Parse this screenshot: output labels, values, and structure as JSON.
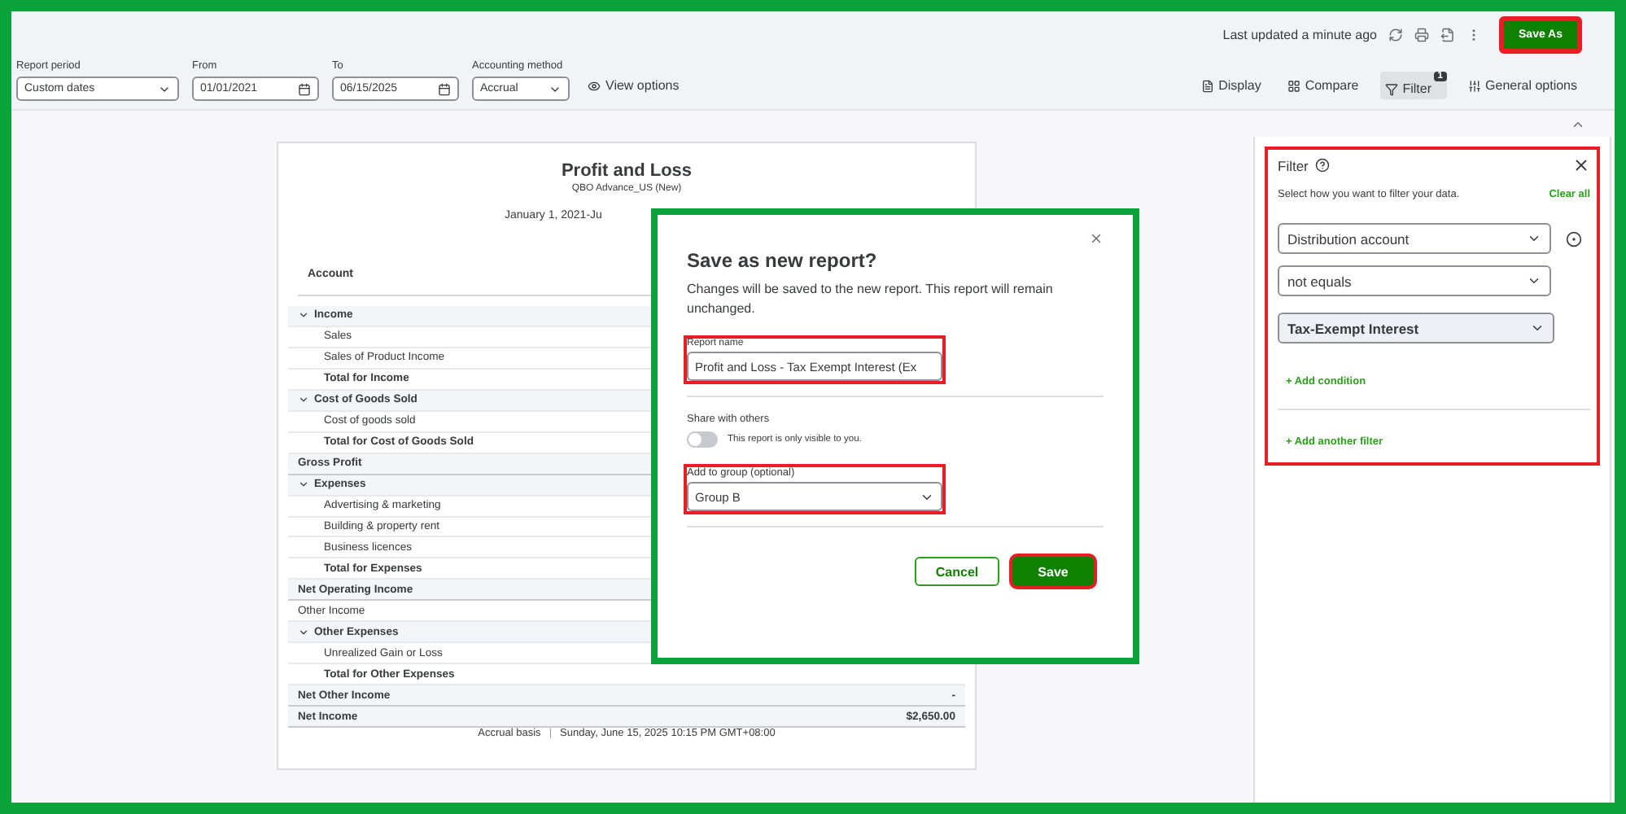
{
  "header": {
    "last_updated": "Last updated a minute ago",
    "save_as": {
      "label": "Save As",
      "highlighted": true
    }
  },
  "controls": [
    {
      "kind": "select",
      "label": "Report period",
      "value": "Custom dates"
    },
    {
      "kind": "date",
      "label": "From",
      "value": "01/01/2021"
    },
    {
      "kind": "date",
      "label": "To",
      "value": "06/15/2025"
    },
    {
      "kind": "select",
      "label": "Accounting method",
      "value": "Accrual"
    }
  ],
  "view_options": "View options",
  "tools": [
    {
      "kind": "display",
      "label": "Display",
      "selected": false
    },
    {
      "kind": "compare",
      "label": "Compare",
      "selected": false
    },
    {
      "kind": "filter",
      "label": "Filter",
      "selected": true,
      "badge": "1"
    },
    {
      "kind": "options",
      "label": "General options",
      "selected": false
    }
  ],
  "report": {
    "title": "Profit and Loss",
    "company": "QBO Advance_US (New)",
    "date_range": "January 1, 2021-Ju",
    "column": "Account",
    "rows": [
      {
        "kind": "section",
        "label": "Income",
        "expanded": true
      },
      {
        "kind": "item",
        "label": "Sales"
      },
      {
        "kind": "item",
        "label": "Sales of Product Income"
      },
      {
        "kind": "total",
        "label": "Total for Income"
      },
      {
        "kind": "section",
        "label": "Cost of Goods Sold",
        "expanded": true
      },
      {
        "kind": "item",
        "label": "Cost of goods sold"
      },
      {
        "kind": "total",
        "label": "Total for Cost of Goods Sold"
      },
      {
        "kind": "summary",
        "label": "Gross Profit"
      },
      {
        "kind": "section",
        "label": "Expenses",
        "expanded": true
      },
      {
        "kind": "item",
        "label": "Advertising & marketing"
      },
      {
        "kind": "item",
        "label": "Building & property rent"
      },
      {
        "kind": "item",
        "label": "Business licences"
      },
      {
        "kind": "total",
        "label": "Total for Expenses"
      },
      {
        "kind": "summary",
        "label": "Net Operating Income"
      },
      {
        "kind": "plain",
        "label": "Other Income"
      },
      {
        "kind": "section",
        "label": "Other Expenses",
        "expanded": true
      },
      {
        "kind": "item",
        "label": "Unrealized Gain or Loss"
      },
      {
        "kind": "total",
        "label": "Total for Other Expenses"
      },
      {
        "kind": "summary",
        "label": "Net Other Income",
        "amount": "-"
      },
      {
        "kind": "summary",
        "label": "Net Income",
        "amount": "$2,650.00"
      }
    ],
    "footer_basis": "Accrual basis",
    "footer_separator": "|",
    "footer_date": "Sunday, June 15, 2025 10:15 PM GMT+08:00"
  },
  "dialog": {
    "highlighted": true,
    "title": "Save as new report?",
    "message": "Changes will be saved to the new report. This report will remain unchanged.",
    "name_field": {
      "label": "Report name",
      "value": "Profit and Loss - Tax Exempt Interest (Ex",
      "highlighted": true
    },
    "share": {
      "label": "Share with others",
      "on": false,
      "note": "This report is only visible to you."
    },
    "group_field": {
      "label": "Add to group (optional)",
      "value": "Group B",
      "highlighted": true
    },
    "buttons": [
      {
        "kind": "secondary",
        "label": "Cancel",
        "highlighted": false
      },
      {
        "kind": "primary",
        "label": "Save",
        "highlighted": true
      }
    ]
  },
  "filter": {
    "highlighted": true,
    "title": "Filter",
    "hint": "Select how you want to filter your data.",
    "clear": "Clear all",
    "conditions": [
      {
        "value": "Distribution account",
        "selected": false,
        "removable": true
      },
      {
        "value": "not equals",
        "selected": false,
        "removable": false
      },
      {
        "value": "Tax-Exempt Interest",
        "selected": true,
        "removable": false
      }
    ],
    "add_condition": "+ Add condition",
    "add_filter": "+ Add another filter"
  }
}
